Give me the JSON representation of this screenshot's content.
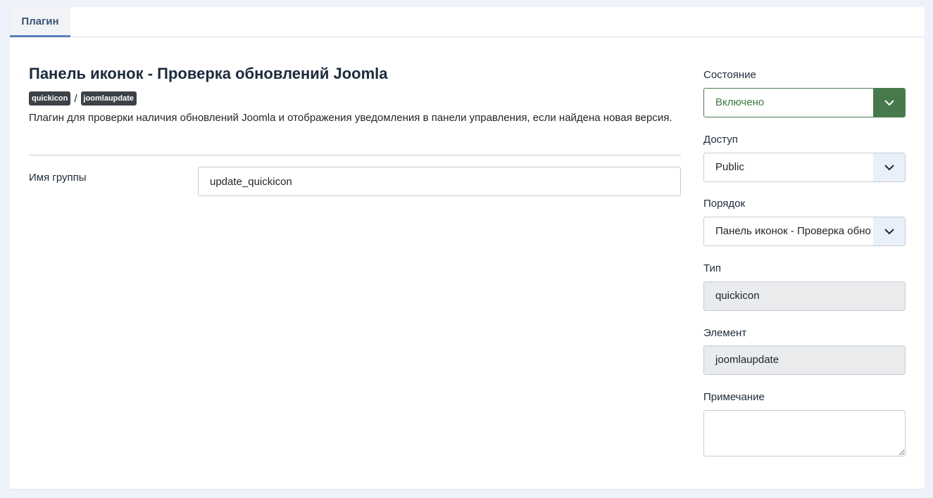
{
  "tabs": [
    {
      "label": "Плагин",
      "active": true
    }
  ],
  "plugin": {
    "title": "Панель иконок - Проверка обновлений Joomla",
    "badges": [
      "quickicon",
      "joomlaupdate"
    ],
    "separator": "/",
    "description": "Плагин для проверки наличия обновлений Joomla и отображения уведомления в панели управления, если найдена новая версия."
  },
  "group": {
    "label": "Имя группы",
    "value": "update_quickicon"
  },
  "sidebar": {
    "state": {
      "label": "Состояние",
      "value": "Включено"
    },
    "access": {
      "label": "Доступ",
      "value": "Public"
    },
    "ordering": {
      "label": "Порядок",
      "value": "Панель иконок - Проверка обновлений Joomla"
    },
    "type": {
      "label": "Тип",
      "value": "quickicon"
    },
    "element": {
      "label": "Элемент",
      "value": "joomlaupdate"
    },
    "note": {
      "label": "Примечание",
      "value": ""
    }
  },
  "colors": {
    "accent": "#5781b8",
    "state_green": "#467a4c",
    "badge_bg": "#3c4248",
    "page_bg": "#eef2fb"
  },
  "icons": {
    "dropdown": "chevron-down-icon"
  }
}
